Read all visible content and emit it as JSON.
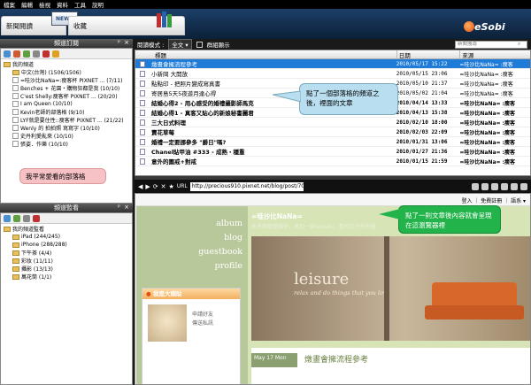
{
  "menu": [
    "檔案",
    "編輯",
    "檢視",
    "資料",
    "工具",
    "說明"
  ],
  "header": {
    "tab_news": "新聞閱讀",
    "tab_fav": "收藏",
    "news_badge": "NEWS",
    "brand": "eSobi"
  },
  "subscribe_panel": {
    "title": "頻道訂閱",
    "pin": "ᵖ",
    "close": "×",
    "tree": [
      {
        "label": "我的頻道",
        "indent": 0,
        "type": "folder"
      },
      {
        "label": "中文(台灣) (1506/1506)",
        "indent": 1,
        "type": "folder"
      },
      {
        "label": "=哇沙比NaNa=:瘦客杯 PIXNET ... (7/11)",
        "indent": 1,
        "type": "feed"
      },
      {
        "label": "Benches + 花園・購物狂都是我 (10/10)",
        "indent": 1,
        "type": "feed"
      },
      {
        "label": "C'est Shelly:瘦客杯 PIXNET ... (20/20)",
        "indent": 1,
        "type": "feed"
      },
      {
        "label": "I am Queen (10/10)",
        "indent": 1,
        "type": "feed"
      },
      {
        "label": "Kevin老師的部落格 (9/10)",
        "indent": 1,
        "type": "feed"
      },
      {
        "label": "LYF就是要住性::瘦客杯 PIXNET ... (21/22)",
        "indent": 1,
        "type": "feed"
      },
      {
        "label": "Wenly 的 拍拍照 寫寫字 (10/10)",
        "indent": 1,
        "type": "feed"
      },
      {
        "label": "史丹利愛亂來 (10/10)",
        "indent": 1,
        "type": "feed"
      },
      {
        "label": "張姿．作樂 (10/10)",
        "indent": 1,
        "type": "feed"
      }
    ]
  },
  "callout_left": "我平常愛看的部落格",
  "monitor_panel": {
    "title": "頻道監看",
    "tree": [
      {
        "label": "我的頻道監看",
        "indent": 0
      },
      {
        "label": "iPad (244/245)",
        "indent": 1
      },
      {
        "label": "iPhone (288/288)",
        "indent": 1
      },
      {
        "label": "下午茶 (4/4)",
        "indent": 1
      },
      {
        "label": "彩妝 (11/11)",
        "indent": 1
      },
      {
        "label": "攝影 (13/13)",
        "indent": 1
      },
      {
        "label": "萬花筒 (1/1)",
        "indent": 1
      }
    ]
  },
  "list_toolbar": {
    "mode_label": "閱讀模式 :",
    "mode_value": "全文",
    "group_label": "群組顯示",
    "search_placeholder": "新聞搜尋"
  },
  "article_list": {
    "columns": [
      "標題",
      "日期",
      "來源"
    ],
    "rows": [
      {
        "title": "燉畫會擁流程參考",
        "date": "2010/05/17 15:22",
        "source": "=哇沙比NaNa= :瘦客",
        "bold": false,
        "selected": true
      },
      {
        "title": "小新岡 大開放",
        "date": "2010/05/15 23:06",
        "source": "=哇沙比NaNa= :瘦客",
        "bold": false,
        "selected": false
      },
      {
        "title": "點點印 - 把照片變成寫真書",
        "date": "2010/05/10 21:37",
        "source": "=哇沙比NaNa= :瘦客",
        "bold": false,
        "selected": false
      },
      {
        "title": "寄居島5天5夜遊月達心得",
        "date": "2010/05/02 21:04",
        "source": "=哇沙比NaNa= :瘦客",
        "bold": false,
        "selected": false
      },
      {
        "title": "結婚心得2 - 用心感受的婚禮攝影師馬克",
        "date": "2010/04/14 13:33",
        "source": "=哇沙比NaNa= :瘦客",
        "bold": true,
        "selected": false
      },
      {
        "title": "結婚心得1 - 真客又貼心的新娘秘書麗君",
        "date": "2010/04/13 15:38",
        "source": "=哇沙比NaNa= :瘦客",
        "bold": true,
        "selected": false
      },
      {
        "title": "三大日式料理",
        "date": "2010/02/10 18:00",
        "source": "=哇沙比NaNa= :瘦客",
        "bold": true,
        "selected": false
      },
      {
        "title": "賣花草莓",
        "date": "2010/02/03 22:09",
        "source": "=哇沙比NaNa= :瘦客",
        "bold": true,
        "selected": false
      },
      {
        "title": "婚禮一定要挪參多 \"爵日\"嗎?",
        "date": "2010/01/31 13:06",
        "source": "=哇沙比NaNa= :瘦客",
        "bold": true,
        "selected": false
      },
      {
        "title": "Chanel貼甲油 #333 - 成熟・穩重",
        "date": "2010/01/27 21:36",
        "source": "=哇沙比NaNa= :瘦客",
        "bold": true,
        "selected": false
      },
      {
        "title": "意外的圍戒+對戒",
        "date": "2010/01/15 21:59",
        "source": "=哇沙比NaNa= :瘦客",
        "bold": true,
        "selected": false
      }
    ]
  },
  "callout_right": "點了一個部落格的頻道之後，裡面的文章",
  "callout_browser": "點了一則文章後內容就會呈現在這瀏覽器裡",
  "browser": {
    "url_label": "URL",
    "url": "http://precious910.pixnet.net/blog/post/7067143",
    "blog_login": "登入 ｜ 免費註冊 ｜ 語系 ▾",
    "nav_links": [
      "album",
      "blog",
      "guestbook",
      "profile"
    ],
    "blog_name": "=哇沙比NaNa=",
    "blog_desc": "朱米與醬醬貓來，再加一味wasabi，重純又不失刺激",
    "leisure_title": "leisure",
    "leisure_sub": "relax and do things that you love",
    "sidebar_title": "我是大頭貼",
    "sidebar_line1": "申請好友",
    "sidebar_line2": "傳送私訊",
    "post_date": "May 17 Mon",
    "post_title": "燉畫會擁流程參考"
  },
  "colors": {
    "selection": "#1e7bd8",
    "callout_pink": "#f6c2c6",
    "callout_blue": "#b9def0",
    "callout_green": "#22b34a"
  }
}
